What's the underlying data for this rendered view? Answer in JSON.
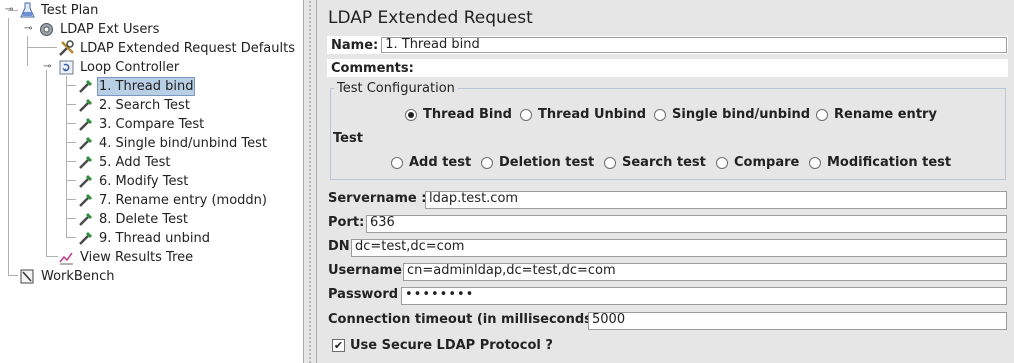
{
  "tree": {
    "test_plan": "Test Plan",
    "ldap_ext_users": "LDAP Ext Users",
    "defaults": "LDAP Extended Request Defaults",
    "loop_controller": "Loop Controller",
    "samplers": [
      "1. Thread bind",
      "2. Search Test",
      "3. Compare Test",
      "4. Single bind/unbind Test",
      "5. Add Test",
      "6. Modify Test",
      "7. Rename entry (moddn)",
      "8. Delete Test",
      "9. Thread unbind"
    ],
    "view_results_tree": "View Results Tree",
    "workbench": "WorkBench"
  },
  "panel": {
    "title": "LDAP Extended Request",
    "name_label": "Name:",
    "name_value": "1. Thread bind",
    "comments_label": "Comments:",
    "comments_value": "",
    "test_config_legend": "Test Configuration",
    "config_options": [
      "Thread Bind",
      "Thread Unbind",
      "Single bind/unbind",
      "Rename entry"
    ],
    "selected_config": "Thread Bind",
    "test_label": "Test",
    "test_options": [
      "Add test",
      "Deletion test",
      "Search test",
      "Compare",
      "Modification test"
    ],
    "servername_label": "Servername :",
    "servername_value": "ldap.test.com",
    "port_label": "Port:",
    "port_value": "636",
    "dn_label": "DN",
    "dn_value": "dc=test,dc=com",
    "username_label": "Username",
    "username_value": "cn=adminldap,dc=test,dc=com",
    "password_label": "Password",
    "password_value": "••••••••",
    "timeout_label": "Connection timeout (in milliseconds)",
    "timeout_value": "5000",
    "secure_label": "Use Secure LDAP Protocol ?",
    "secure_checked": true
  },
  "colors": {
    "selection": "#b8cfe5",
    "panel_bg": "#e6e6e6",
    "fieldset_border": "#b8c6d8"
  }
}
